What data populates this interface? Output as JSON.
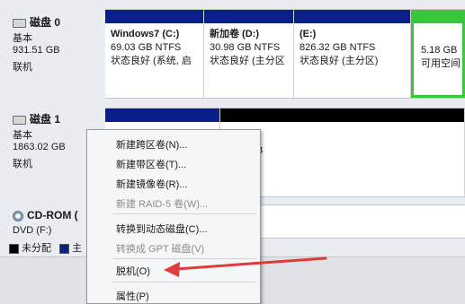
{
  "disks": [
    {
      "name": "磁盘 0",
      "type": "基本",
      "size": "931.51 GB",
      "status": "联机"
    },
    {
      "name": "磁盘 1",
      "type": "基本",
      "size": "1863.02 GB",
      "status": "联机"
    }
  ],
  "cdrom": {
    "name": "CD-ROM (",
    "drive": "DVD (F:)"
  },
  "disk0_partitions": [
    {
      "name": "Windows7  (C:)",
      "info": "69.03 GB NTFS",
      "status": "状态良好 (系统, 启"
    },
    {
      "name": "新加卷  (D:)",
      "info": "30.98 GB NTFS",
      "status": "状态良好 (主分区"
    },
    {
      "name": "(E:)",
      "info": "826.32 GB NTFS",
      "status": "状态良好 (主分区)"
    },
    {
      "name": "",
      "info": "5.18 GB",
      "status": "可用空间"
    }
  ],
  "disk1_partial": {
    "line1": "B",
    "line2": ""
  },
  "context_menu": {
    "items": [
      {
        "label": "新建跨区卷(N)...",
        "enabled": true
      },
      {
        "label": "新建带区卷(T)...",
        "enabled": true
      },
      {
        "label": "新建镜像卷(R)...",
        "enabled": true
      },
      {
        "label": "新建 RAID-5 卷(W)...",
        "enabled": false
      },
      {
        "label": "转换到动态磁盘(C)...",
        "enabled": true
      },
      {
        "label": "转换成 GPT 磁盘(V)",
        "enabled": false
      },
      {
        "label": "脱机(O)",
        "enabled": true
      },
      {
        "label": "属性(P)",
        "enabled": true
      }
    ]
  },
  "legend": [
    {
      "label": "未分配",
      "color": "#000000"
    },
    {
      "label": "主",
      "color": "#0b1f8c"
    }
  ],
  "annotation": {
    "arrow_color": "#e03a3a"
  },
  "colors": {
    "primary_partition": "#0b1f8c",
    "unallocated": "#000000",
    "free_space": "#38c73c"
  }
}
